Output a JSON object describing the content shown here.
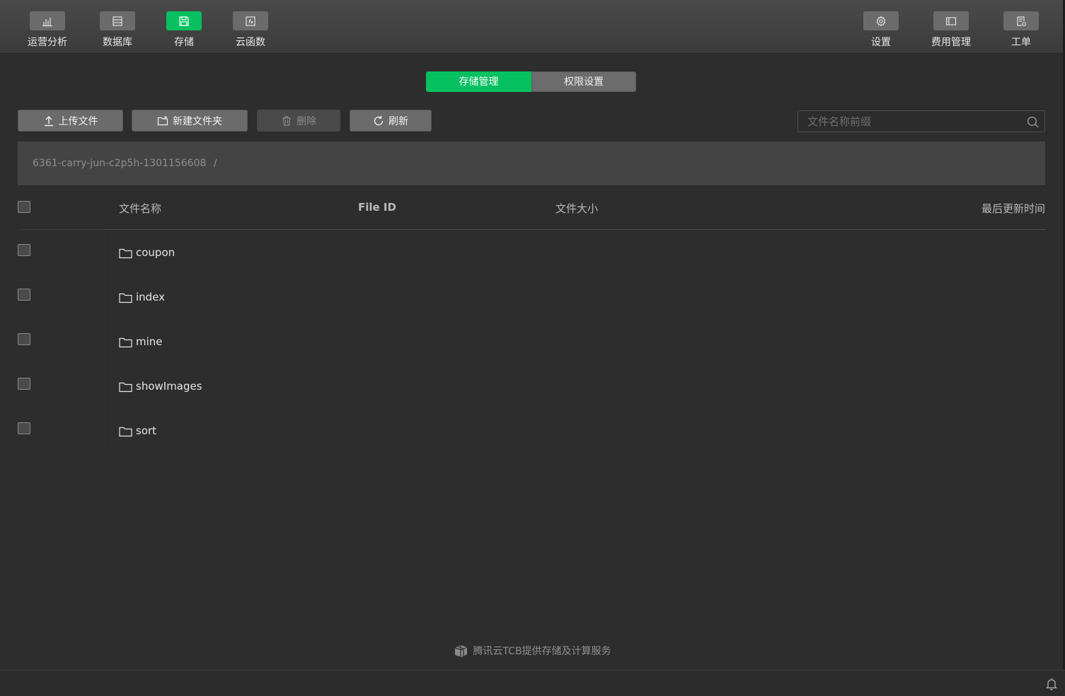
{
  "nav_left": [
    {
      "label": "运营分析",
      "icon": "bar-chart-icon",
      "active": false
    },
    {
      "label": "数据库",
      "icon": "database-icon",
      "active": false
    },
    {
      "label": "存储",
      "icon": "storage-icon",
      "active": true
    },
    {
      "label": "云函数",
      "icon": "cloud-function-icon",
      "active": false
    }
  ],
  "nav_right": [
    {
      "label": "设置",
      "icon": "gear-icon"
    },
    {
      "label": "费用管理",
      "icon": "billing-icon"
    },
    {
      "label": "工单",
      "icon": "ticket-icon"
    }
  ],
  "tabs": [
    {
      "label": "存储管理",
      "active": true
    },
    {
      "label": "权限设置",
      "active": false
    }
  ],
  "toolbar": {
    "upload_label": "上传文件",
    "new_folder_label": "新建文件夹",
    "delete_label": "删除",
    "refresh_label": "刷新"
  },
  "search": {
    "placeholder": "文件名称前缀",
    "value": ""
  },
  "breadcrumb": {
    "bucket": "6361-carry-jun-c2p5h-1301156608",
    "separator": "/"
  },
  "table": {
    "columns": [
      "文件名称",
      "File ID",
      "文件大小",
      "最后更新时间"
    ],
    "rows": [
      {
        "name": "coupon",
        "type": "folder"
      },
      {
        "name": "index",
        "type": "folder"
      },
      {
        "name": "mine",
        "type": "folder"
      },
      {
        "name": "showImages",
        "type": "folder"
      },
      {
        "name": "sort",
        "type": "folder"
      }
    ]
  },
  "footer": {
    "text": "腾讯云TCB提供存储及计算服务"
  },
  "colors": {
    "accent": "#07c160",
    "background": "#2d2d2d",
    "topbar": "#444444"
  }
}
